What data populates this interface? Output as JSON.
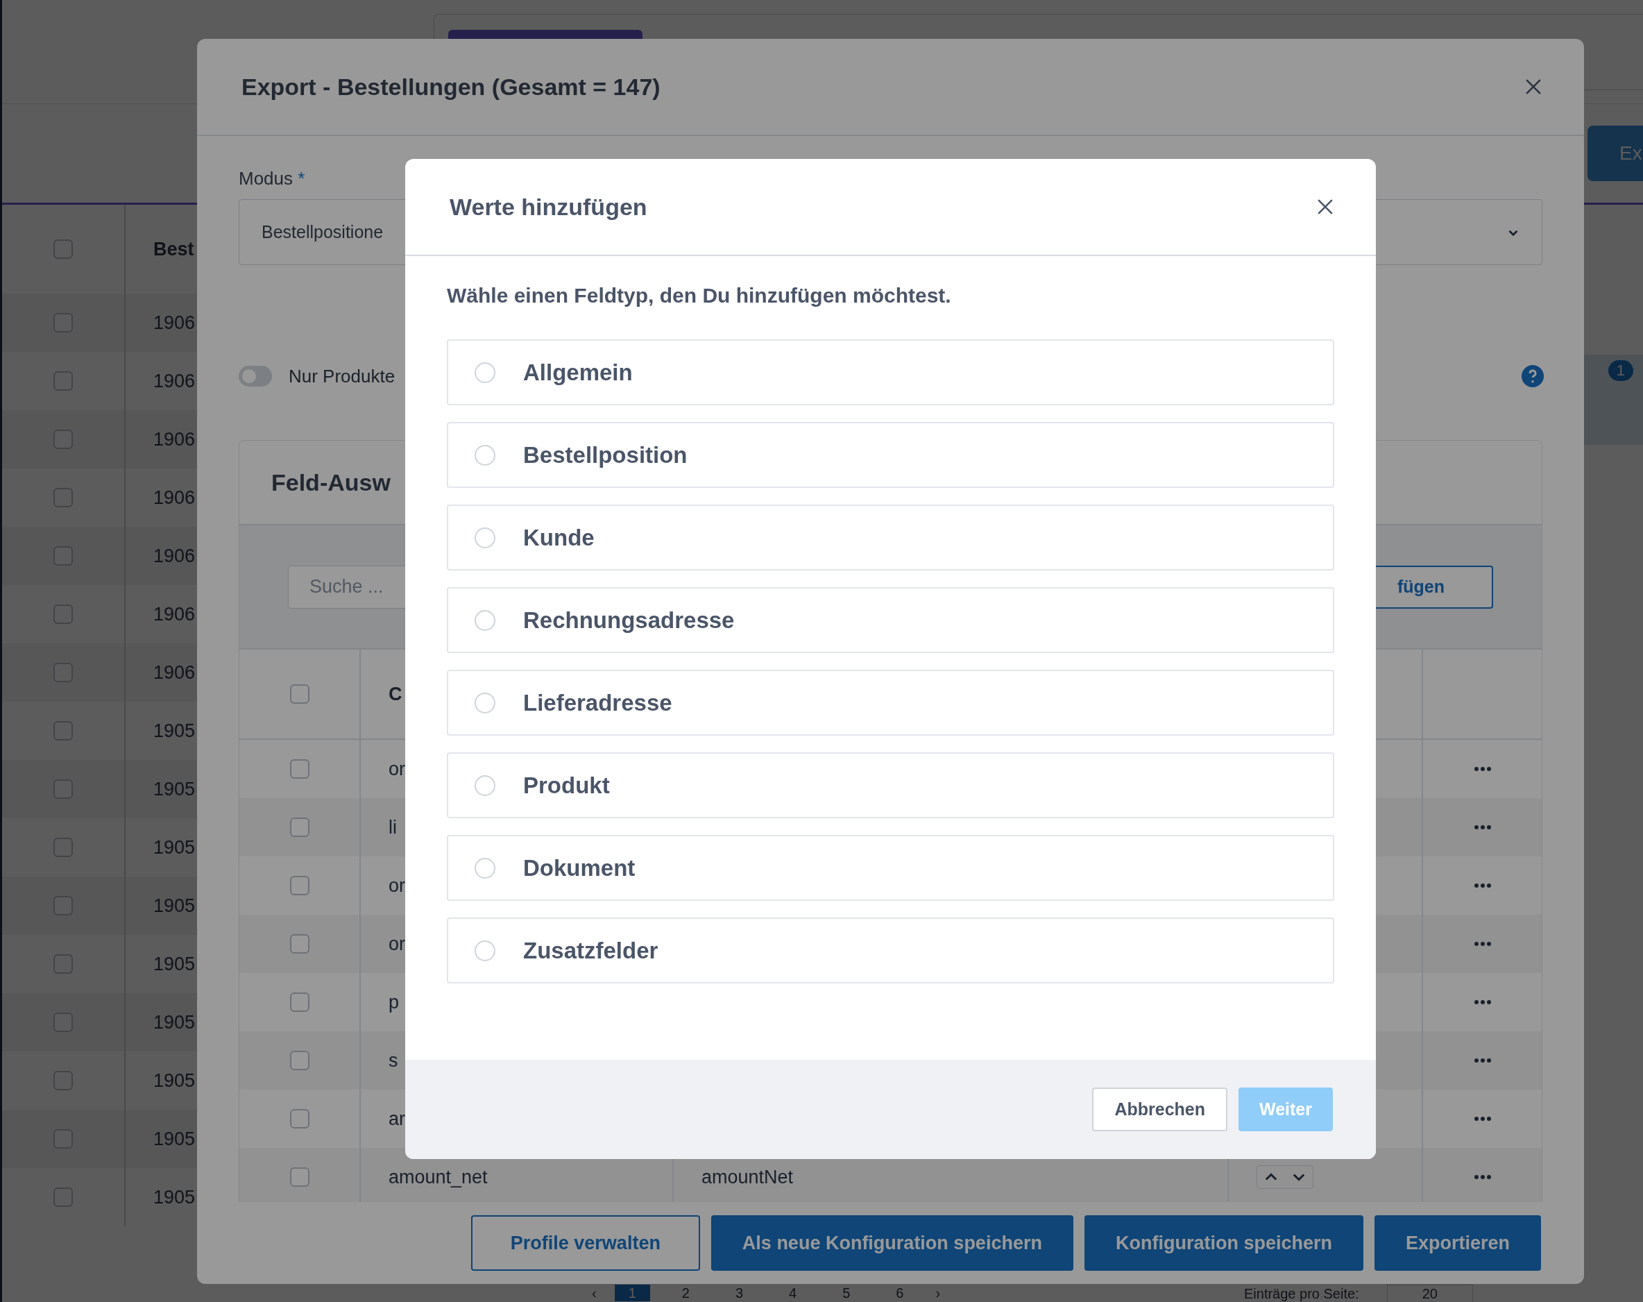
{
  "page": {
    "header_button": "Ex",
    "filter_badge": "1",
    "table": {
      "header_checked": false,
      "columns": [
        "Best"
      ],
      "rows": [
        {
          "checked": false,
          "cells": [
            "1906"
          ]
        },
        {
          "checked": false,
          "cells": [
            "1906"
          ]
        },
        {
          "checked": false,
          "cells": [
            "1906"
          ]
        },
        {
          "checked": false,
          "cells": [
            "1906"
          ]
        },
        {
          "checked": false,
          "cells": [
            "1906"
          ]
        },
        {
          "checked": false,
          "cells": [
            "1906"
          ]
        },
        {
          "checked": false,
          "cells": [
            "1906"
          ]
        },
        {
          "checked": false,
          "cells": [
            "1905"
          ]
        },
        {
          "checked": false,
          "cells": [
            "1905"
          ]
        },
        {
          "checked": false,
          "cells": [
            "1905"
          ]
        },
        {
          "checked": false,
          "cells": [
            "1905"
          ]
        },
        {
          "checked": false,
          "cells": [
            "1905"
          ]
        },
        {
          "checked": false,
          "cells": [
            "1905"
          ]
        },
        {
          "checked": false,
          "cells": [
            "1905"
          ]
        },
        {
          "checked": false,
          "cells": [
            "1905"
          ]
        },
        {
          "checked": false,
          "cells": [
            "1905"
          ]
        }
      ]
    },
    "pagination": {
      "prev": "‹",
      "pages": [
        {
          "label": "1",
          "selected": true
        },
        {
          "label": "2",
          "selected": false
        },
        {
          "label": "3",
          "selected": false
        },
        {
          "label": "4",
          "selected": false
        },
        {
          "label": "5",
          "selected": false
        },
        {
          "label": "6",
          "selected": false
        }
      ],
      "next": "›",
      "per_page_label": "Einträge pro Seite:",
      "per_page_value": "20"
    }
  },
  "export_dialog": {
    "title": "Export - Bestellungen (Gesamt = 147)",
    "mode": {
      "label": "Modus",
      "required_mark": "*",
      "value": "Bestellpositione"
    },
    "toggle": {
      "label": "Nur Produkte",
      "on": false
    },
    "field_card": {
      "title": "Feld-Ausw",
      "search": {
        "placeholder": "Suche ..."
      },
      "add_button": "fügen",
      "header_checked": false,
      "columns": [
        "C"
      ],
      "rows": [
        {
          "checked": false,
          "cells": [
            "or"
          ]
        },
        {
          "checked": false,
          "cells": [
            "li"
          ]
        },
        {
          "checked": false,
          "cells": [
            "or"
          ]
        },
        {
          "checked": false,
          "cells": [
            "or"
          ]
        },
        {
          "checked": false,
          "cells": [
            "p"
          ]
        },
        {
          "checked": false,
          "cells": [
            "s"
          ]
        },
        {
          "checked": false,
          "cells": [
            "ar"
          ]
        },
        {
          "checked": false,
          "cells": [
            "amount_net",
            "amountNet"
          ]
        }
      ]
    },
    "buttons": [
      {
        "label": "Profile verwalten",
        "kind": "outline"
      },
      {
        "label": "Als neue Konfiguration speichern",
        "kind": "primary"
      },
      {
        "label": "Konfiguration speichern",
        "kind": "primary"
      },
      {
        "label": "Exportieren",
        "kind": "primary"
      }
    ]
  },
  "add_values_dialog": {
    "title": "Werte hinzufügen",
    "prompt": "Wähle einen Feldtyp, den Du hinzufügen möchtest.",
    "options": [
      {
        "label": "Allgemein",
        "selected": false
      },
      {
        "label": "Bestellposition",
        "selected": false
      },
      {
        "label": "Kunde",
        "selected": false
      },
      {
        "label": "Rechnungsadresse",
        "selected": false
      },
      {
        "label": "Lieferadresse",
        "selected": false
      },
      {
        "label": "Produkt",
        "selected": false
      },
      {
        "label": "Dokument",
        "selected": false
      },
      {
        "label": "Zusatzfelder",
        "selected": false
      }
    ],
    "buttons": [
      {
        "label": "Abbrechen",
        "kind": "secondary",
        "disabled": false
      },
      {
        "label": "Weiter",
        "kind": "primary",
        "disabled": true
      }
    ]
  }
}
